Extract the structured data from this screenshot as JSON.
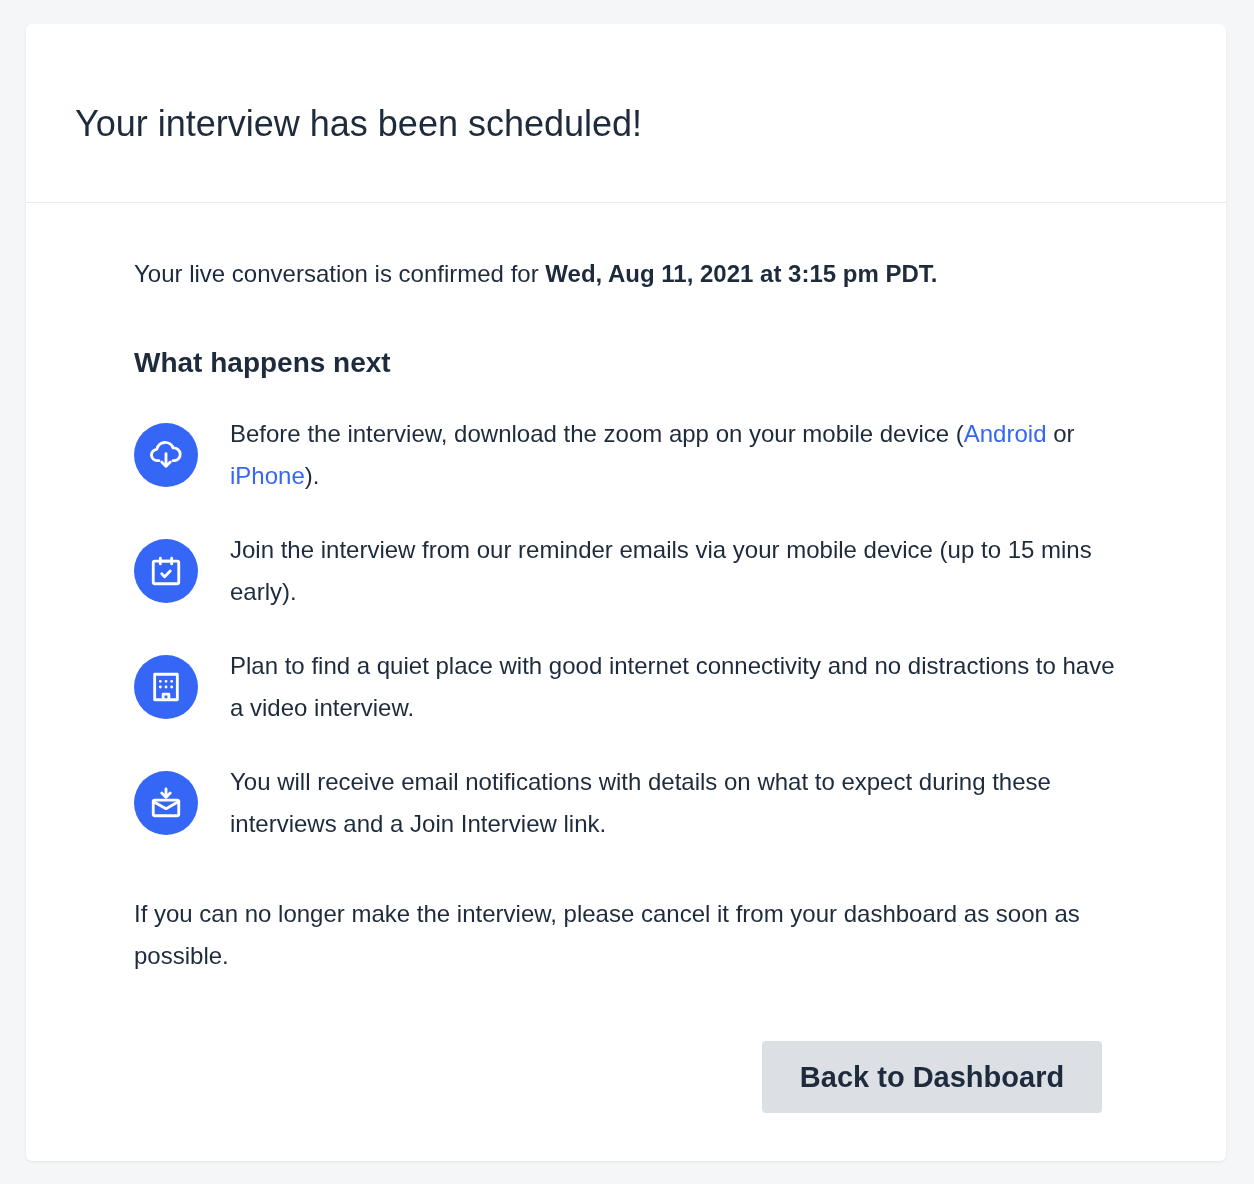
{
  "title": "Your interview has been scheduled!",
  "confirmation": "Your live conversation is confirmed for **Wed, Aug 11, 2021 at 3:15 pm PDT.**",
  "next_heading": "What happens next",
  "steps": [
    {
      "kind": "cloud-download",
      "parts": [
        {
          "text": "Before the interview, download the zoom app on your mobile device ("
        },
        {
          "link": "Android"
        },
        {
          "text": " or "
        },
        {
          "link": "iPhone"
        },
        {
          "text": ")."
        }
      ]
    },
    {
      "kind": "calendar-check",
      "parts": [
        {
          "text": "Join the interview from our reminder emails via your mobile device (up to 15 mins early)."
        }
      ]
    },
    {
      "kind": "building",
      "parts": [
        {
          "text": "Plan to find a quiet place with good internet connectivity and no distractions to have a video interview."
        }
      ]
    },
    {
      "kind": "mail-download",
      "parts": [
        {
          "text": "You will receive email notifications with details on what to expect during these interviews and a Join Interview link."
        }
      ]
    }
  ],
  "cancel_note": "If you can no longer make the interview, please cancel it from your dashboard as soon as possible.",
  "button": "Back to Dashboard"
}
